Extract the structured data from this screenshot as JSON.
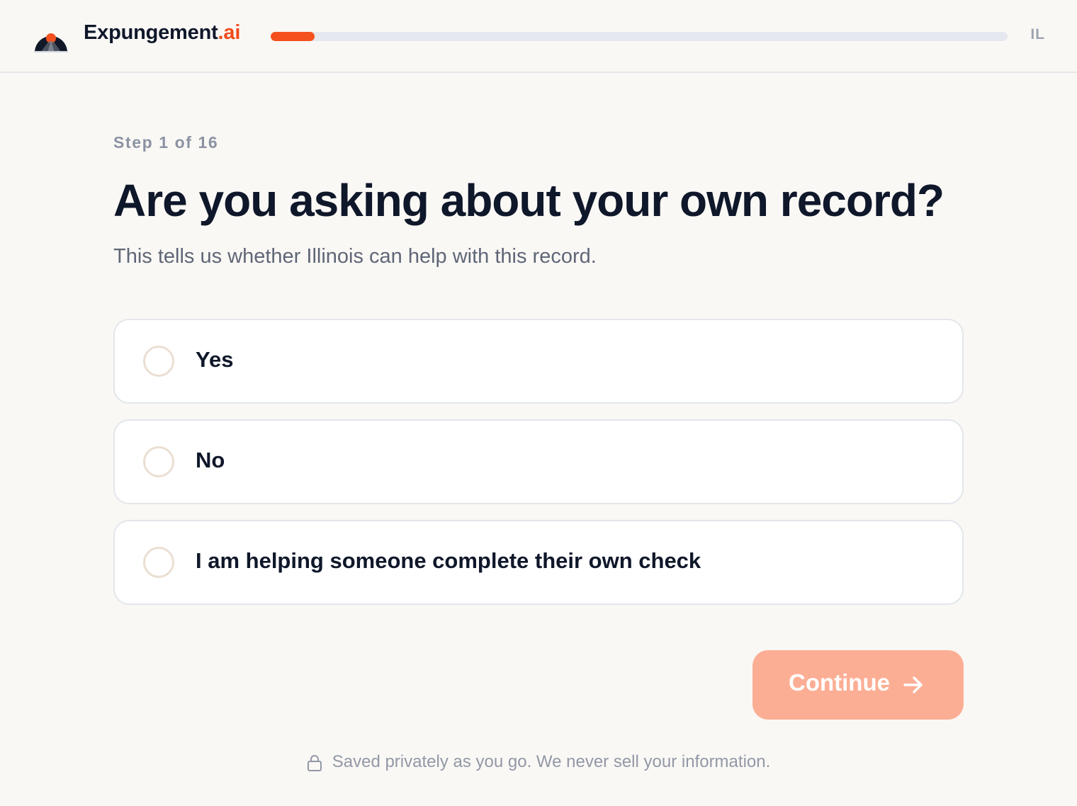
{
  "header": {
    "brand_name": "Expungement",
    "brand_tld": ".ai",
    "state": "IL",
    "progress_fraction": 0.06,
    "logo_icon": "sunrise-road-logo",
    "colors": {
      "accent": "#f4511e",
      "brand_dark": "#0f172a"
    }
  },
  "main": {
    "step_label": "Step 1 of 16",
    "title": "Are you asking about your own record?",
    "subtitle": "This tells us whether Illinois can help with this record.",
    "options": [
      {
        "label": "Yes",
        "selected": false
      },
      {
        "label": "No",
        "selected": false
      },
      {
        "label": "I am helping someone complete their own check",
        "selected": false
      }
    ],
    "continue_label": "Continue",
    "continue_icon": "arrow-right-icon",
    "continue_color": "#fcae94"
  },
  "footer": {
    "text": "Saved privately as you go. We never sell your information.",
    "icon": "lock-icon"
  }
}
